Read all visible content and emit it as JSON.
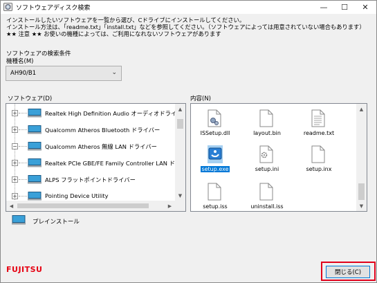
{
  "window": {
    "title": "ソフトウェアディスク検索",
    "minimize_glyph": "—",
    "maximize_glyph": "☐",
    "close_glyph": "✕"
  },
  "instructions": [
    "インストールしたいソフトウェアを一覧から選び、Cドライブにインストールしてください。",
    "インストール方法は、「readme.txt」「install.txt」などを参照してください。（ソフトウェアによっては用意されていない場合もあります）",
    "★★ 注意 ★★ お使いの機種によっては、ご利用になれないソフトウェアがあります"
  ],
  "search": {
    "section_label": "ソフトウェアの検索条件",
    "model_label": "機種名(M)",
    "model_value": "AH90/B1"
  },
  "software": {
    "label": "ソフトウェア(D)",
    "items": [
      {
        "label": "Realtek High Definition Audio オーディオドライバ",
        "icon": "monitor-icon"
      },
      {
        "label": "Qualcomm Atheros Bluetooth ドライバー",
        "icon": "monitor-icon"
      },
      {
        "label": "Qualcomm Atheros 無線 LAN ドライバー",
        "icon": "monitor-icon"
      },
      {
        "label": "Realtek PCIe GBE/FE Family Controller LAN ド",
        "icon": "monitor-icon"
      },
      {
        "label": "ALPS フラットポイントドライバー",
        "icon": "monitor-icon"
      },
      {
        "label": "Pointing Device Utility",
        "icon": "monitor-icon"
      }
    ]
  },
  "contents": {
    "label": "内容(N)",
    "files": [
      {
        "name": "ISSetup.dll",
        "icon": "dll-file-icon"
      },
      {
        "name": "layout.bin",
        "icon": "file-icon"
      },
      {
        "name": "readme.txt",
        "icon": "text-file-icon"
      },
      {
        "name": "setup.exe",
        "icon": "setup-exe-icon"
      },
      {
        "name": "setup.ini",
        "icon": "settings-file-icon"
      },
      {
        "name": "setup.inx",
        "icon": "file-icon"
      },
      {
        "name": "setup.iss",
        "icon": "file-icon"
      },
      {
        "name": "uninstall.iss",
        "icon": "file-icon"
      }
    ]
  },
  "legend": {
    "preinstall_label": "プレインストール"
  },
  "footer": {
    "brand": "FUJITSU",
    "close_label": "閉じる(C)",
    "highlight_color": "#e0001a",
    "brand_color": "#e60012"
  }
}
